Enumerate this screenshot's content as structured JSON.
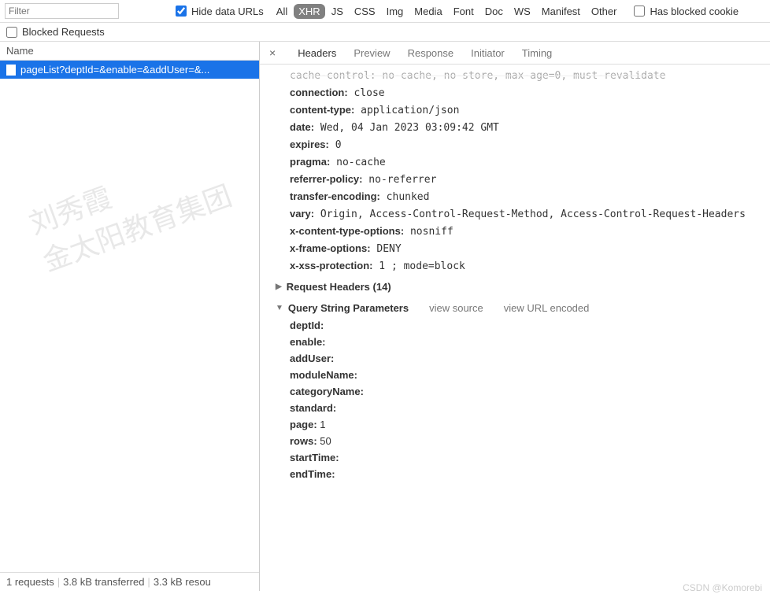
{
  "toolbar": {
    "filter_placeholder": "Filter",
    "hide_data_urls": "Hide data URLs",
    "filters": [
      "All",
      "XHR",
      "JS",
      "CSS",
      "Img",
      "Media",
      "Font",
      "Doc",
      "WS",
      "Manifest",
      "Other"
    ],
    "active_filter": "XHR",
    "has_blocked_cookies": "Has blocked cookie",
    "blocked_requests": "Blocked Requests"
  },
  "left": {
    "col_name": "Name",
    "request": "pageList?deptId=&enable=&addUser=&...",
    "watermark_l1": "刘秀霞",
    "watermark_l2": "金太阳教育集团"
  },
  "status": {
    "requests": "1 requests",
    "transferred": "3.8 kB transferred",
    "resources": "3.3 kB resou"
  },
  "tabs": {
    "headers": "Headers",
    "preview": "Preview",
    "response": "Response",
    "initiator": "Initiator",
    "timing": "Timing"
  },
  "response_headers_cut": "cache-control: no-cache, no-store, max-age=0, must-revalidate",
  "response_headers": [
    {
      "k": "connection",
      "v": "close"
    },
    {
      "k": "content-type",
      "v": "application/json"
    },
    {
      "k": "date",
      "v": "Wed, 04 Jan 2023 03:09:42 GMT"
    },
    {
      "k": "expires",
      "v": "0"
    },
    {
      "k": "pragma",
      "v": "no-cache"
    },
    {
      "k": "referrer-policy",
      "v": "no-referrer"
    },
    {
      "k": "transfer-encoding",
      "v": "chunked"
    },
    {
      "k": "vary",
      "v": "Origin, Access-Control-Request-Method, Access-Control-Request-Headers"
    },
    {
      "k": "x-content-type-options",
      "v": "nosniff"
    },
    {
      "k": "x-frame-options",
      "v": "DENY"
    },
    {
      "k": "x-xss-protection",
      "v": "1 ; mode=block"
    }
  ],
  "sections": {
    "request_headers": "Request Headers (14)",
    "query_params": "Query String Parameters",
    "view_source": "view source",
    "view_url": "view URL encoded"
  },
  "query_params": [
    {
      "k": "deptId",
      "v": ""
    },
    {
      "k": "enable",
      "v": ""
    },
    {
      "k": "addUser",
      "v": ""
    },
    {
      "k": "moduleName",
      "v": ""
    },
    {
      "k": "categoryName",
      "v": ""
    },
    {
      "k": "standard",
      "v": ""
    },
    {
      "k": "page",
      "v": "1"
    },
    {
      "k": "rows",
      "v": "50"
    },
    {
      "k": "startTime",
      "v": ""
    },
    {
      "k": "endTime",
      "v": ""
    }
  ],
  "csdn": "CSDN @Komorebi"
}
